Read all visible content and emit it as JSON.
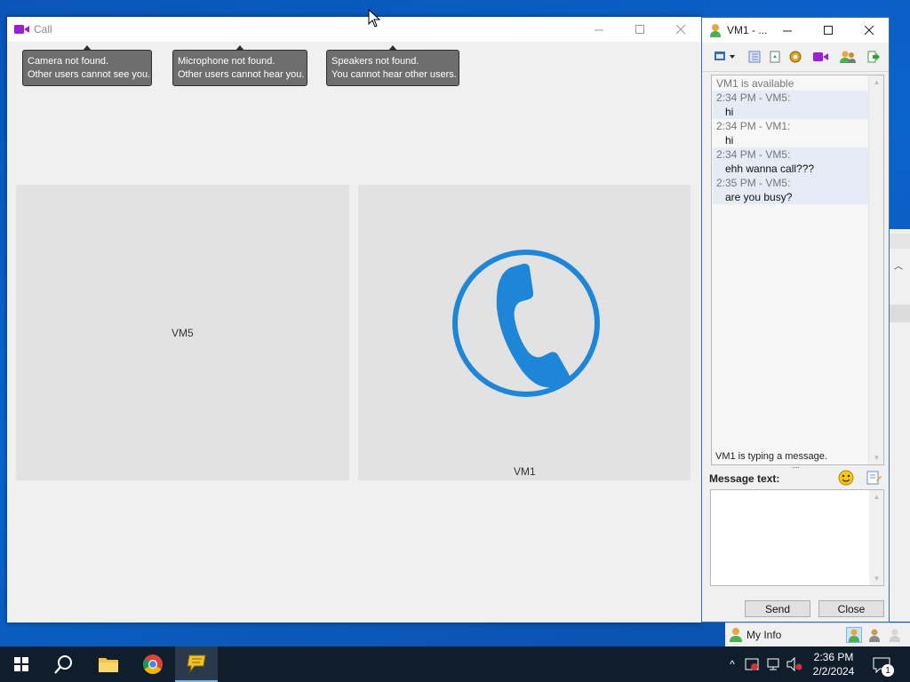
{
  "call_window": {
    "title": "Call",
    "tooltips": [
      {
        "line1": "Camera not found.",
        "line2": "Other users cannot see you."
      },
      {
        "line1": "Microphone not found.",
        "line2": "Other users cannot hear you."
      },
      {
        "line1": "Speakers not found.",
        "line2": "You cannot hear other users."
      }
    ],
    "panes": {
      "left_label": "VM5",
      "right_label": "VM1"
    },
    "colors": {
      "phone_icon": "#1e86d6",
      "pane_bg": "#e2e2e2"
    }
  },
  "chat_window": {
    "title": "VM1 - ...",
    "history": [
      {
        "kind": "status",
        "text": "VM1 is available"
      },
      {
        "kind": "meta",
        "text": "2:34 PM - VM5:"
      },
      {
        "kind": "msg",
        "text": "hi"
      },
      {
        "kind": "meta",
        "text": "2:34 PM - VM1:"
      },
      {
        "kind": "msg",
        "text": "hi"
      },
      {
        "kind": "meta",
        "text": "2:34 PM - VM5:"
      },
      {
        "kind": "msg",
        "text": "ehh wanna call???"
      },
      {
        "kind": "meta",
        "text": "2:35 PM - VM5:"
      },
      {
        "kind": "msg",
        "text": "are you busy?"
      }
    ],
    "typing_status": "VM1 is typing a message.",
    "message_label": "Message text:",
    "message_value": "",
    "send_label": "Send",
    "close_label": "Close"
  },
  "status_bar": {
    "myinfo_label": "My Info"
  },
  "taskbar": {
    "time": "2:36 PM",
    "date": "2/2/2024",
    "notification_count": "1"
  }
}
